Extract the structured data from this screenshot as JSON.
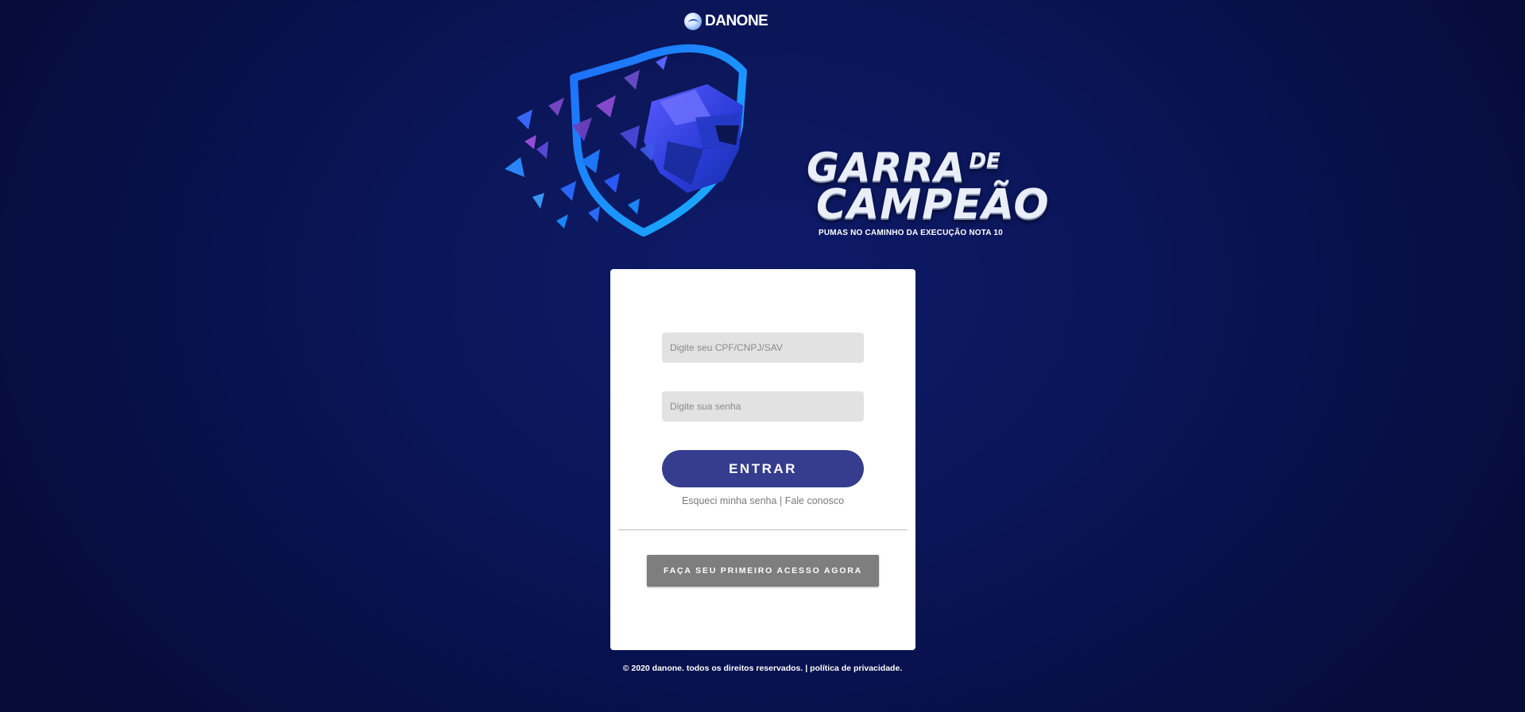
{
  "header": {
    "brand_name": "DANONE",
    "logo_icon": "danone-globe-icon"
  },
  "hero": {
    "title_line1": "GARRA",
    "title_connector": "DE",
    "title_line2": "CAMPEÃO",
    "tagline": "PUMAS NO CAMINHO DA EXECUÇÃO NOTA 10",
    "emblem_icon": "puma-shield-icon"
  },
  "login": {
    "cpf_placeholder": "Digite seu CPF/CNPJ/SAV",
    "cpf_value": "",
    "password_placeholder": "Digite sua senha",
    "password_value": "",
    "submit_label": "ENTRAR",
    "forgot_password_label": "Esqueci minha senha",
    "separator": "|",
    "contact_label": "Fale conosco",
    "first_access_label": "FAÇA SEU PRIMEIRO ACESSO AGORA"
  },
  "footer": {
    "copyright": "© 2020 danone. todos os direitos reservados.",
    "separator": "|",
    "privacy_label": "política de privacidade."
  },
  "colors": {
    "background": "#0b1659",
    "card": "#ffffff",
    "input_bg": "#e2e2e2",
    "primary_button": "#363d8e",
    "secondary_button": "#7e7e7e",
    "shield_accent": "#1aa0ff"
  }
}
